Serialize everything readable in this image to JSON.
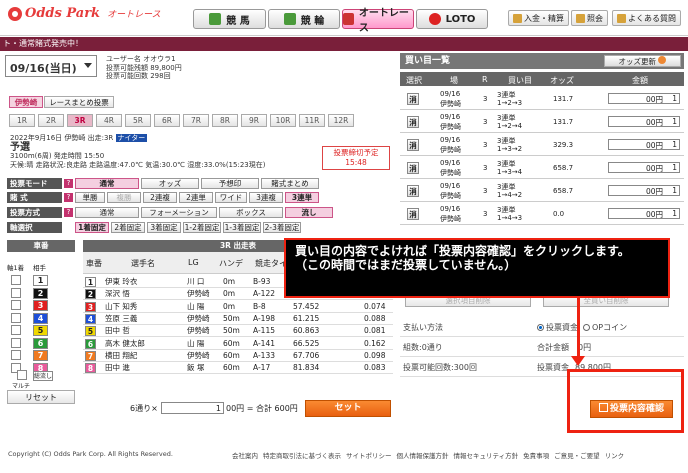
{
  "header": {
    "logo_text": "Odds Park",
    "logo_sub": "オートレース",
    "tabs": [
      {
        "label": "競 馬"
      },
      {
        "label": "競 輪"
      },
      {
        "label": "オートレース"
      },
      {
        "label": "LOTO"
      }
    ],
    "utils": [
      {
        "label": "入金・精算"
      },
      {
        "label": "照会"
      },
      {
        "label": "よくある質問"
      }
    ]
  },
  "announce": "ト・通常賭式発売中！",
  "date_select": "09/16(当日)",
  "user": {
    "line1": "ユーザー名 オオウラ1",
    "line2": "投票可能残額 89,800円",
    "line3": "投票可能回数 298回"
  },
  "venue_tabs": [
    {
      "label": "伊勢崎"
    },
    {
      "label": "レースまとめ投票"
    }
  ],
  "races": [
    "1R",
    "2R",
    "3R",
    "4R",
    "5R",
    "6R",
    "7R",
    "8R",
    "9R",
    "10R",
    "11R",
    "12R"
  ],
  "race": {
    "date_line": "2022年9月16日  伊勢崎  出走:3R",
    "night": "ナイター",
    "title": "予選",
    "detail": "3100m(6周) 発走時間 15:50",
    "weather": "天候:晴 走路状況:良走路 走路温度:47.0℃ 気温:30.0℃ 湿度:33.0%(15:23現在)",
    "deadline_label": "投票締切予定",
    "deadline_time": "15:48"
  },
  "mode": {
    "label": "投票モード",
    "options": [
      "通常",
      "オッズ",
      "予想印",
      "賭式まとめ"
    ]
  },
  "bet_type": {
    "label": "賭 式",
    "options": [
      "単勝",
      "複勝",
      "2連複",
      "2連単",
      "ワイド",
      "3連複",
      "3連単"
    ]
  },
  "method": {
    "label": "投票方式",
    "options": [
      "通常",
      "フォーメーション",
      "ボックス",
      "流し"
    ]
  },
  "axis": {
    "label": "軸選択",
    "options": [
      "1着固定",
      "2着固定",
      "3着固定",
      "1-2着固定",
      "1-3着固定",
      "2-3着固定"
    ]
  },
  "car_panel": {
    "title": "車番",
    "head1": "軸1着",
    "head2": "相手",
    "multi": "マルチ",
    "all_label": "総流し",
    "reset": "リセット"
  },
  "entries": {
    "title": "3R 出走表",
    "columns": [
      "車番",
      "選手名",
      "LG",
      "ハンデ",
      "競走タイム",
      "",
      "オッズ"
    ],
    "rows": [
      {
        "no": "1",
        "name": "伊東 玲衣",
        "lg": "川 口",
        "hande": "0m",
        "rank": "B-93",
        "time": "",
        "odds": ""
      },
      {
        "no": "2",
        "name": "深沢 悟",
        "lg": "伊勢崎",
        "hande": "0m",
        "rank": "A-122",
        "time": "59.022",
        "odds": "0.075"
      },
      {
        "no": "3",
        "name": "山下 知秀",
        "lg": "山 陽",
        "hande": "0m",
        "rank": "B-8",
        "time": "57.452",
        "odds": "0.074"
      },
      {
        "no": "4",
        "name": "笠原 三義",
        "lg": "伊勢崎",
        "hande": "50m",
        "rank": "A-198",
        "time": "61.215",
        "odds": "0.088"
      },
      {
        "no": "5",
        "name": "田中 哲",
        "lg": "伊勢崎",
        "hande": "50m",
        "rank": "A-115",
        "time": "60.863",
        "odds": "0.081"
      },
      {
        "no": "6",
        "name": "高木 健太郎",
        "lg": "山 陽",
        "hande": "60m",
        "rank": "A-141",
        "time": "66.525",
        "odds": "0.162"
      },
      {
        "no": "7",
        "name": "横田 翔紀",
        "lg": "伊勢崎",
        "hande": "60m",
        "rank": "A-133",
        "time": "67.706",
        "odds": "0.098"
      },
      {
        "no": "8",
        "name": "田中 進",
        "lg": "飯 塚",
        "hande": "60m",
        "rank": "A-17",
        "time": "81.834",
        "odds": "0.083"
      }
    ]
  },
  "bet_bar": {
    "count_label": "6通り×",
    "amount": "1",
    "unit": "00円 = 合計 600円",
    "set": "セット"
  },
  "selected": {
    "title": "買い目一覧",
    "odds_update": "オッズ更新",
    "columns": [
      "選択",
      "場",
      "R",
      "買い目",
      "オッズ",
      "金額"
    ],
    "rows": [
      {
        "del": "消",
        "date": "09/16",
        "place": "伊勢崎",
        "r": "3",
        "type": "3連単",
        "combo": "1→2→3",
        "odds": "131.7",
        "amount": "1",
        "unit": "00円"
      },
      {
        "del": "消",
        "date": "09/16",
        "place": "伊勢崎",
        "r": "3",
        "type": "3連単",
        "combo": "1→2→4",
        "odds": "131.7",
        "amount": "1",
        "unit": "00円"
      },
      {
        "del": "消",
        "date": "09/16",
        "place": "伊勢崎",
        "r": "3",
        "type": "3連単",
        "combo": "1→3→2",
        "odds": "329.3",
        "amount": "1",
        "unit": "00円"
      },
      {
        "del": "消",
        "date": "09/16",
        "place": "伊勢崎",
        "r": "3",
        "type": "3連単",
        "combo": "1→3→4",
        "odds": "658.7",
        "amount": "1",
        "unit": "00円"
      },
      {
        "del": "消",
        "date": "09/16",
        "place": "伊勢崎",
        "r": "3",
        "type": "3連単",
        "combo": "1→4→2",
        "odds": "658.7",
        "amount": "1",
        "unit": "00円"
      },
      {
        "del": "消",
        "date": "09/16",
        "place": "伊勢崎",
        "r": "3",
        "type": "3連単",
        "combo": "1→4→3",
        "odds": "0.0",
        "amount": "1",
        "unit": "00円"
      }
    ],
    "del_selected": "選択項目削除",
    "del_all": "全買い目削除"
  },
  "payment": {
    "label": "支払い方法",
    "opt1": "投票資金",
    "opt2": "OPコイン",
    "count_label": "組数:0通り",
    "total_label": "合計金額",
    "total_value": "0円",
    "remaining_label": "投票可能回数:300回",
    "fund_label": "投票資金",
    "fund_value": "89,800円",
    "confirm": "投票内容確認"
  },
  "overlay": {
    "line1": "買い目の内容でよければ「投票内容確認」をクリックします。",
    "line2": "（この時間ではまだ投票していません。）"
  },
  "footer": {
    "copyright": "Copyright (C) Odds Park Corp. All Rights Reserved.",
    "links": [
      "会社案内",
      "特定商取引法に基づく表示",
      "サイトポリシー",
      "個人情報保護方針",
      "情報セキュリティ方針",
      "免責事項",
      "ご意見・ご要望",
      "リンク"
    ]
  },
  "colors": {
    "car": [
      "#ffffff",
      "#111111",
      "#e02020",
      "#1e4fd8",
      "#f0d800",
      "#2a9a3a",
      "#f07a20",
      "#e95a9b"
    ]
  }
}
